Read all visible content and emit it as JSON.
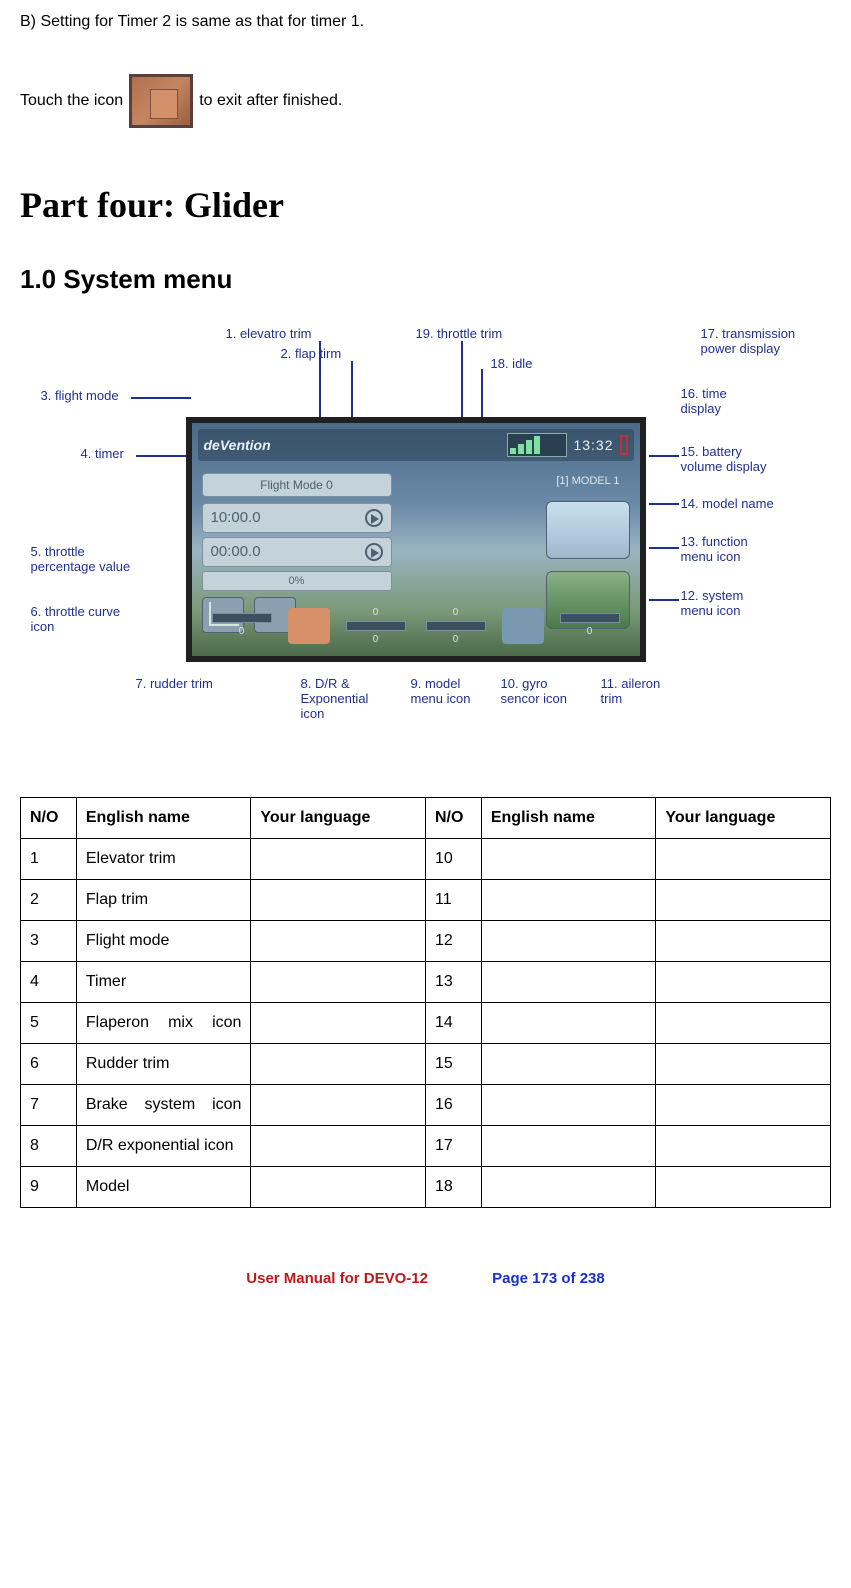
{
  "intro": {
    "line1": "B) Setting for Timer 2 is same as that for timer 1.",
    "touch_before": "Touch the icon",
    "touch_after": " to exit after finished."
  },
  "headings": {
    "part": "Part four: Glider",
    "section": "1.0 System menu"
  },
  "screen": {
    "brand": "deVention",
    "flight_mode": "Flight Mode 0",
    "timer1": "10:00.0",
    "timer2": "00:00.0",
    "percent": "0%",
    "model": "[1] MODEL 1",
    "clock": "13:32",
    "trim_zero": "0"
  },
  "callouts": {
    "c1": "1.  elevatro trim",
    "c2": "2. flap tirm",
    "c3": "3. flight mode",
    "c4": "4. timer",
    "c5": "5. throttle\npercentage value",
    "c6": "6. throttle curve\nicon",
    "c7": "7. rudder trim",
    "c8": "8. D/R &\nExponential\nicon",
    "c9": "9. model\nmenu icon",
    "c10": "10. gyro\nsencor icon",
    "c11": "11. aileron\ntrim",
    "c12": "12. system\nmenu icon",
    "c13": "13. function\nmenu icon",
    "c14": "14. model name",
    "c15": "15. battery\nvolume display",
    "c16": "16. time\ndisplay",
    "c17": "17. transmission\npower display",
    "c18": "18. idle",
    "c19": "19. throttle trim"
  },
  "table": {
    "headers": {
      "no": "N/O",
      "en": "English name",
      "lang": "Your language"
    },
    "left": [
      {
        "no": "1",
        "en": "Elevator trim"
      },
      {
        "no": "2",
        "en": "Flap trim"
      },
      {
        "no": "3",
        "en": "Flight mode"
      },
      {
        "no": "4",
        "en": "Timer"
      },
      {
        "no": "5",
        "en": "Flaperon mix icon",
        "justify": true
      },
      {
        "no": "6",
        "en": "Rudder trim"
      },
      {
        "no": "7",
        "en": "Brake system icon",
        "justify": true
      },
      {
        "no": "8",
        "en": "D/R exponential icon"
      },
      {
        "no": "9",
        "en": "Model"
      }
    ],
    "right": [
      {
        "no": "10",
        "en": ""
      },
      {
        "no": "11",
        "en": ""
      },
      {
        "no": "12",
        "en": ""
      },
      {
        "no": "13",
        "en": ""
      },
      {
        "no": "14",
        "en": ""
      },
      {
        "no": "15",
        "en": ""
      },
      {
        "no": "16",
        "en": ""
      },
      {
        "no": "17",
        "en": ""
      },
      {
        "no": "18",
        "en": ""
      }
    ]
  },
  "footer": {
    "title": "User Manual for DEVO-12",
    "page": "Page 173 of 238"
  }
}
